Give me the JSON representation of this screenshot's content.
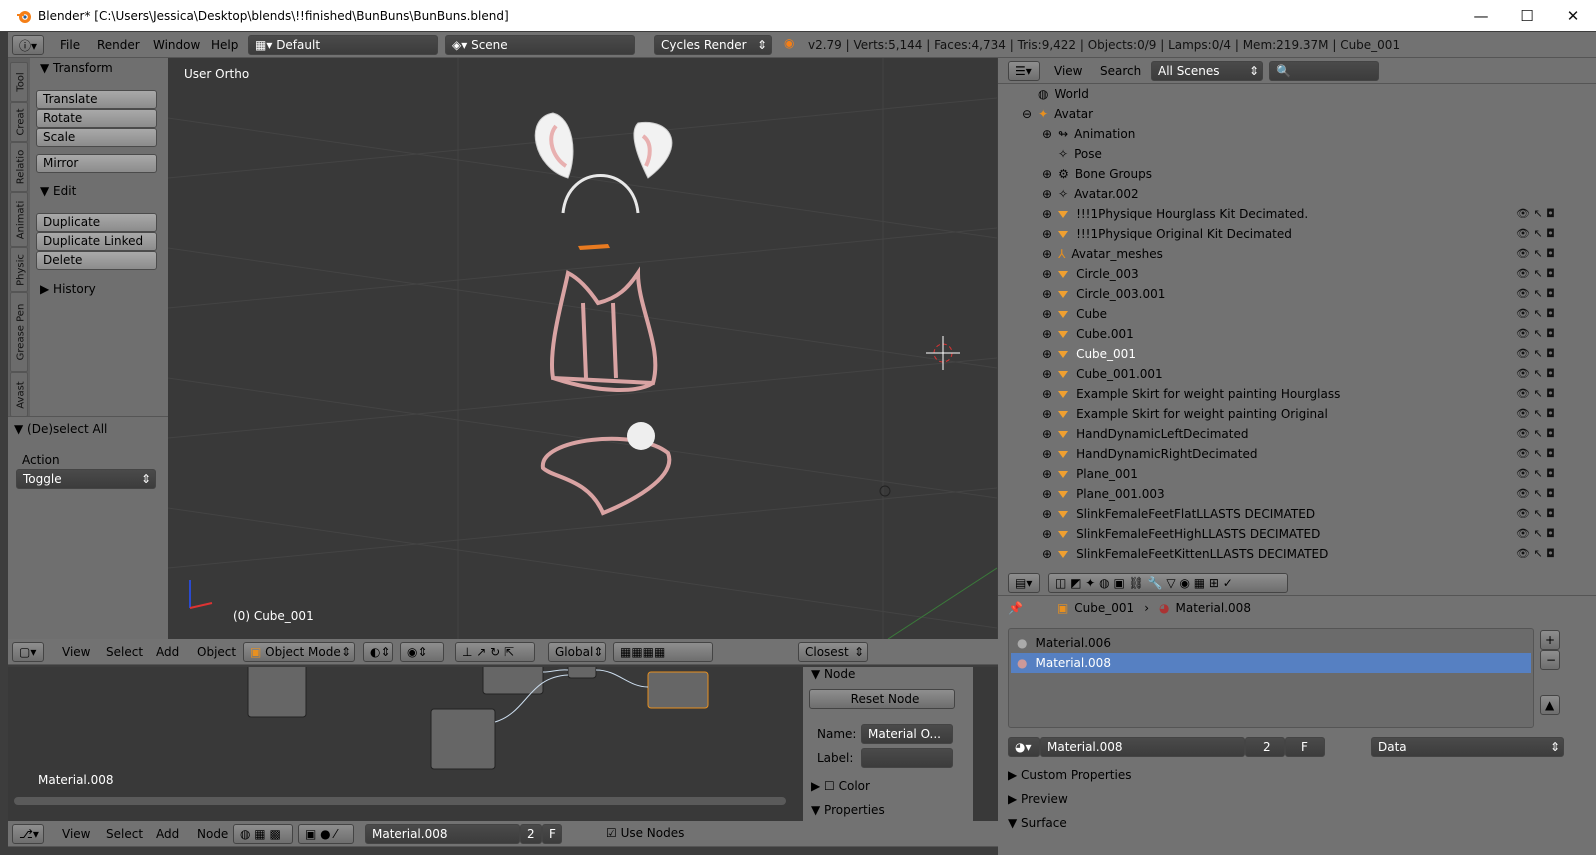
{
  "title": "Blender* [C:\\Users\\Jessica\\Desktop\\blends\\!!finished\\BunBuns\\BunBuns.blend]",
  "info": {
    "menus": [
      "File",
      "Render",
      "Window",
      "Help"
    ],
    "layout": "Default",
    "scene": "Scene",
    "engine": "Cycles Render",
    "stats": "v2.79 | Verts:5,144 | Faces:4,734 | Tris:9,422 | Objects:0/9 | Lamps:0/4 | Mem:219.37M | Cube_001"
  },
  "tool": {
    "tabs": [
      "Tool",
      "Creat",
      "Relatio",
      "Animati",
      "Physic",
      "Grease Pen",
      "Avast"
    ],
    "transform": "Transform",
    "buttons": [
      "Translate",
      "Rotate",
      "Scale"
    ],
    "mirror": "Mirror",
    "edit": "Edit",
    "edit_buttons": [
      "Duplicate",
      "Duplicate Linked",
      "Delete"
    ],
    "history": "History",
    "deselect": "(De)select All",
    "action": "Action",
    "toggle": "Toggle"
  },
  "viewport": {
    "label": "User Ortho",
    "object": "(0) Cube_001",
    "menus": [
      "View",
      "Select",
      "Add",
      "Object"
    ],
    "mode": "Object Mode",
    "orient": "Global",
    "snap": "Closest"
  },
  "outliner": {
    "menus": [
      "View",
      "Search"
    ],
    "scenes": "All Scenes",
    "rows": [
      "World",
      "Avatar",
      "Animation",
      "Pose",
      "Bone Groups",
      "Avatar.002",
      "!!!1Physique Hourglass Kit Decimated.",
      "!!!1Physique Original Kit Decimated",
      "Avatar_meshes",
      "Circle_003",
      "Circle_003.001",
      "Cube",
      "Cube.001",
      "Cube_001",
      "Cube_001.001",
      "Example Skirt for weight painting Hourglass",
      "Example Skirt for weight painting Original",
      "HandDynamicLeftDecimated",
      "HandDynamicRightDecimated",
      "Plane_001",
      "Plane_001.003",
      "SlinkFemaleFeetFlatLLASTS DECIMATED",
      "SlinkFemaleFeetHighLLASTS DECIMATED",
      "SlinkFemaleFeetKittenLLASTS DECIMATED"
    ]
  },
  "props": {
    "object": "Cube_001",
    "material": "Material.008",
    "slots": [
      "Material.006",
      "Material.008"
    ],
    "mat_name": "Material.008",
    "users": "2",
    "fake": "F",
    "link": "Data",
    "sections": [
      "Custom Properties",
      "Preview",
      "Surface"
    ]
  },
  "node": {
    "material_label": "Material.008",
    "panel": "Node",
    "reset": "Reset Node",
    "name_label": "Name:",
    "name_value": "Material O...",
    "label_label": "Label:",
    "color": "Color",
    "properties": "Properties",
    "menus": [
      "View",
      "Select",
      "Add",
      "Node"
    ],
    "material": "Material.008",
    "users": "2",
    "fake": "F",
    "use_nodes": "Use Nodes"
  }
}
